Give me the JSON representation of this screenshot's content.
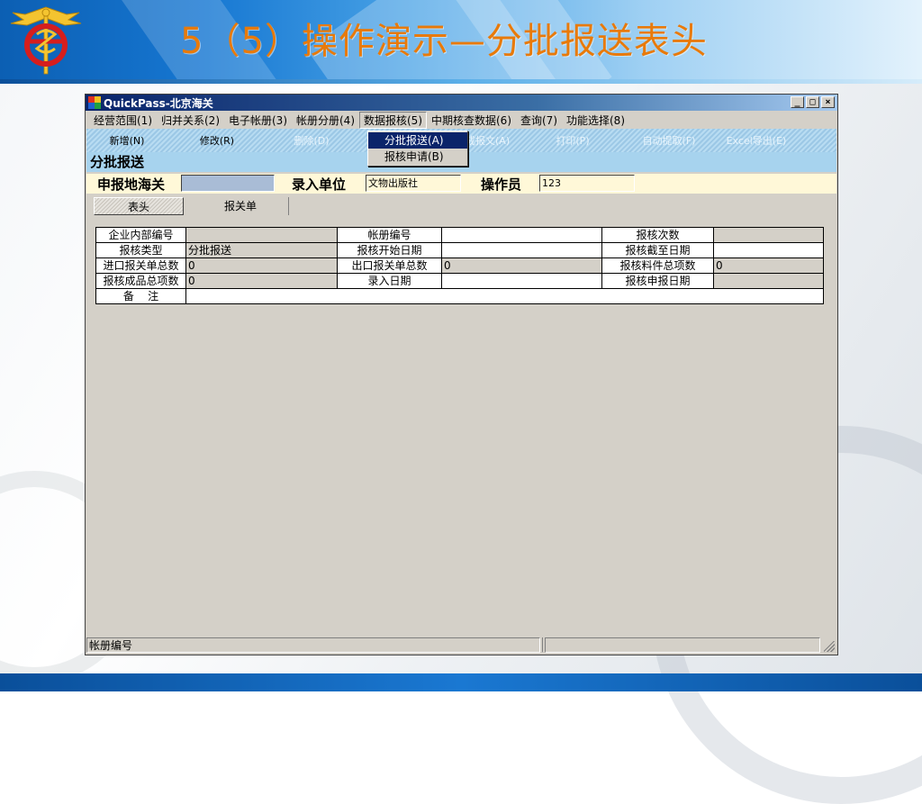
{
  "slide": {
    "title": "5（5）操作演示—分批报送表头"
  },
  "window": {
    "title": "QuickPass-北京海关",
    "controls": {
      "minimize": "_",
      "maximize": "□",
      "close": "×"
    }
  },
  "menu": [
    "经营范围(1)",
    "归并关系(2)",
    "电子帐册(3)",
    "帐册分册(4)",
    "数据报核(5)",
    "中期核查数据(6)",
    "查询(7)",
    "功能选择(8)"
  ],
  "dropdown": [
    "分批报送(A)",
    "报核申请(B)"
  ],
  "toolbar": [
    {
      "label": "新增(N)"
    },
    {
      "label": "修改(R)"
    },
    {
      "label": "删除(D)"
    },
    {
      "label": "生成报文(A)"
    },
    {
      "label": "打印(P)"
    },
    {
      "label": "自动提取(F)"
    },
    {
      "label": "Excel导出(E)"
    }
  ],
  "section_title": "分批报送",
  "infobar": {
    "customs_label": "申报地海关",
    "customs_value": "",
    "unit_label": "录入单位",
    "unit_value": "文物出版社",
    "operator_label": "操作员",
    "operator_value": "123"
  },
  "tabs": [
    "表头",
    "报关单"
  ],
  "grid": [
    [
      "企业内部编号",
      "",
      "帐册编号",
      "",
      "报核次数",
      ""
    ],
    [
      "报核类型",
      "分批报送",
      "报核开始日期",
      "",
      "报核截至日期",
      ""
    ],
    [
      "进口报关单总数",
      "0",
      "出口报关单总数",
      "0",
      "报核料件总项数",
      "0"
    ],
    [
      "报核成品总项数",
      "0",
      "录入日期",
      "",
      "报核申报日期",
      ""
    ]
  ],
  "remarks_label": "备    注",
  "remarks_value": "",
  "statusbar": [
    "帐册编号",
    "",
    ""
  ],
  "colors": {
    "accent_title": "#e87a0a",
    "toolbar": "#9cc8e6",
    "infobar": "#fff8d8",
    "titlebar": "#0a246a"
  }
}
